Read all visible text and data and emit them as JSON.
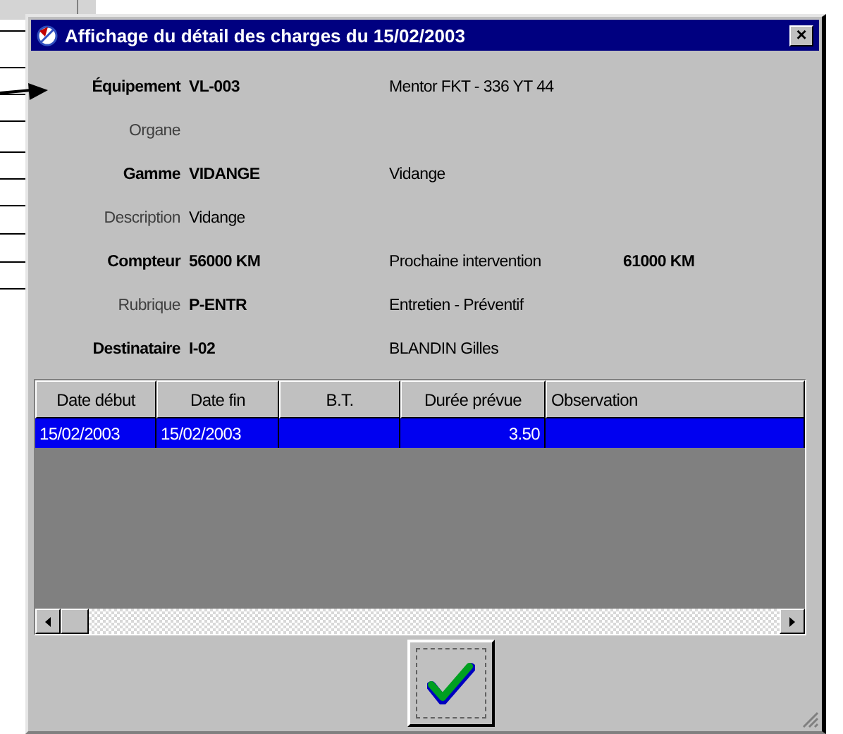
{
  "window": {
    "title": "Affichage du détail des charges du 15/02/2003",
    "close": "×"
  },
  "fields": [
    {
      "label": "Équipement",
      "required": true,
      "value": "VL-003",
      "value_bold": true,
      "detail": "Mentor FKT - 336 YT 44"
    },
    {
      "label": "Organe",
      "required": false
    },
    {
      "label": "Gamme",
      "required": true,
      "value": "VIDANGE",
      "value_bold": true,
      "detail": "Vidange"
    },
    {
      "label": "Description",
      "required": false,
      "value": "Vidange",
      "value_bold": false
    },
    {
      "label": "Compteur",
      "required": true,
      "value": "56000  KM",
      "value_bold": true,
      "detail": "Prochaine intervention",
      "detail_value": "61000  KM"
    },
    {
      "label": "Rubrique",
      "required": false,
      "value": "P-ENTR",
      "value_bold": true,
      "detail": "Entretien - Préventif"
    },
    {
      "label": "Destinataire",
      "required": true,
      "value": "I-02",
      "value_bold": true,
      "detail": "BLANDIN Gilles"
    }
  ],
  "table": {
    "columns": [
      {
        "label": "Date début"
      },
      {
        "label": "Date fin"
      },
      {
        "label": "B.T."
      },
      {
        "label": "Durée prévue"
      },
      {
        "label": "Observation"
      }
    ],
    "rows": [
      {
        "selected": true,
        "cells": [
          "15/02/2003",
          "15/02/2003",
          "",
          "3.50",
          ""
        ]
      }
    ]
  },
  "buttons": [
    {
      "kind": "ok"
    }
  ]
}
